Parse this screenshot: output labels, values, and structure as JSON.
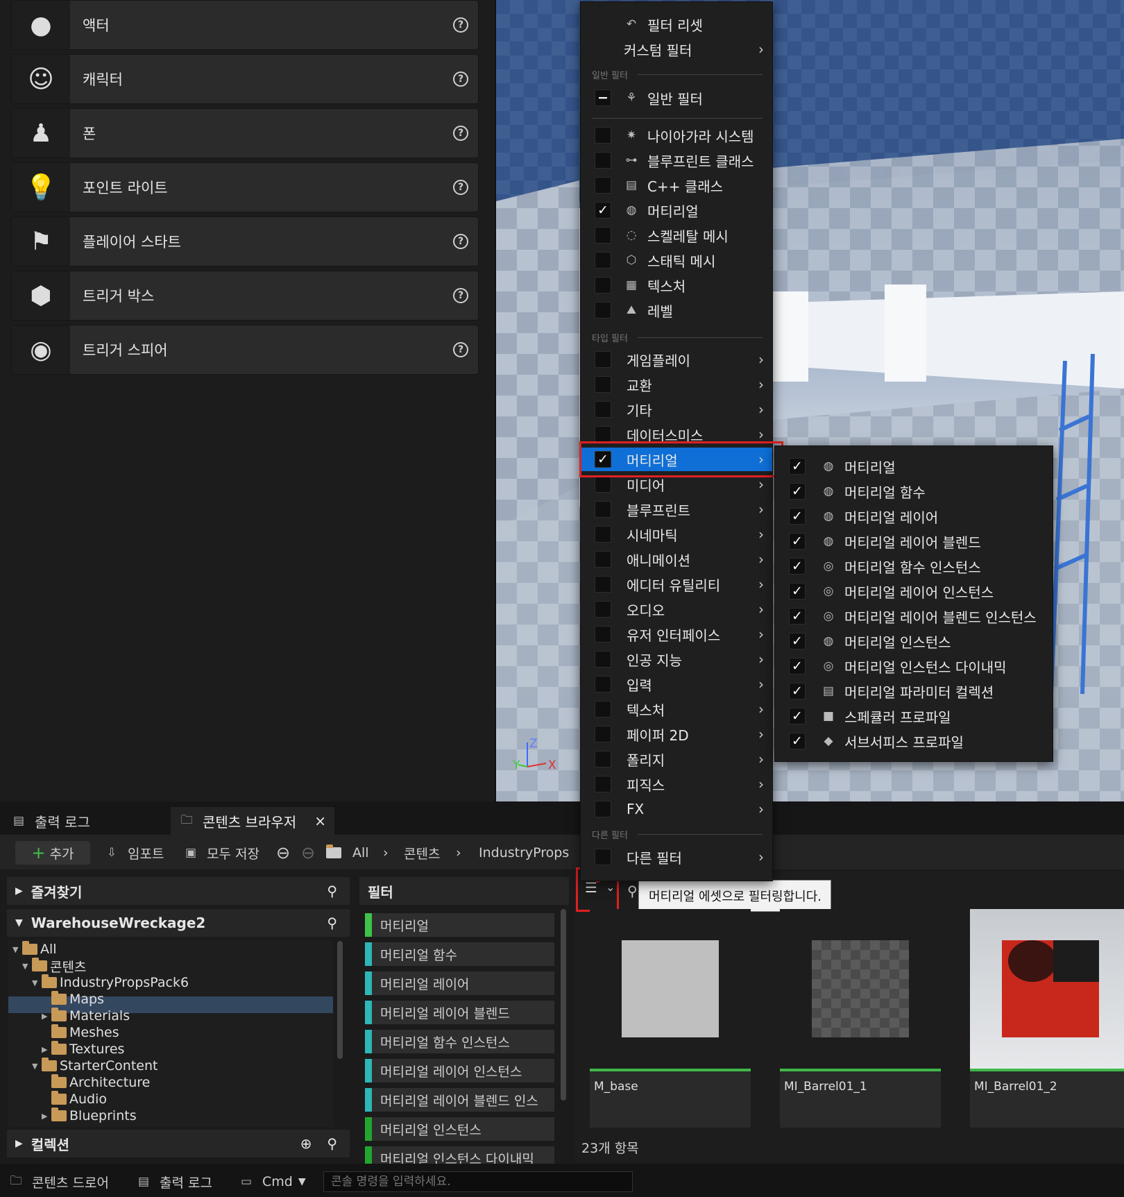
{
  "place_actors": [
    {
      "label": "액터",
      "icon": "sphere-icon"
    },
    {
      "label": "캐릭터",
      "icon": "character-icon"
    },
    {
      "label": "폰",
      "icon": "pawn-icon"
    },
    {
      "label": "포인트 라이트",
      "icon": "lightbulb-icon"
    },
    {
      "label": "플레이어 스타트",
      "icon": "player-start-flag-icon"
    },
    {
      "label": "트리거 박스",
      "icon": "trigger-box-icon"
    },
    {
      "label": "트리거 스피어",
      "icon": "trigger-sphere-icon"
    }
  ],
  "viewport": {
    "axis_x": "X",
    "axis_y": "Y",
    "axis_z": "Z"
  },
  "filter_menu": {
    "reset": "필터 리셋",
    "custom": "커스텀 필터",
    "common_header": "일반 필터",
    "common_filter": "일반 필터",
    "common_items": [
      {
        "label": "나이아가라 시스템",
        "checked": false
      },
      {
        "label": "블루프린트 클래스",
        "checked": false
      },
      {
        "label": "C++ 클래스",
        "checked": false
      },
      {
        "label": "머티리얼",
        "checked": true
      },
      {
        "label": "스켈레탈 메시",
        "checked": false
      },
      {
        "label": "스태틱 메시",
        "checked": false
      },
      {
        "label": "텍스처",
        "checked": false
      },
      {
        "label": "레벨",
        "checked": false
      }
    ],
    "type_header": "타입 필터",
    "type_items": [
      {
        "label": "게임플레이",
        "checked": false
      },
      {
        "label": "교환",
        "checked": false
      },
      {
        "label": "기타",
        "checked": false
      },
      {
        "label": "데이터스미스",
        "checked": false
      },
      {
        "label": "머티리얼",
        "checked": true,
        "highlighted": true
      },
      {
        "label": "미디어",
        "checked": false
      },
      {
        "label": "블루프린트",
        "checked": false
      },
      {
        "label": "시네마틱",
        "checked": false
      },
      {
        "label": "애니메이션",
        "checked": false
      },
      {
        "label": "에디터 유틸리티",
        "checked": false
      },
      {
        "label": "오디오",
        "checked": false
      },
      {
        "label": "유저 인터페이스",
        "checked": false
      },
      {
        "label": "인공 지능",
        "checked": false
      },
      {
        "label": "입력",
        "checked": false
      },
      {
        "label": "텍스처",
        "checked": false
      },
      {
        "label": "페이퍼 2D",
        "checked": false
      },
      {
        "label": "폴리지",
        "checked": false
      },
      {
        "label": "피직스",
        "checked": false
      },
      {
        "label": "FX",
        "checked": false
      }
    ],
    "other_header": "다른 필터",
    "other_filter": "다른 필터"
  },
  "material_submenu": [
    "머티리얼",
    "머티리얼 함수",
    "머티리얼 레이어",
    "머티리얼 레이어 블렌드",
    "머티리얼 함수 인스턴스",
    "머티리얼 레이어 인스턴스",
    "머티리얼 레이어 블렌드 인스턴스",
    "머티리얼 인스턴스",
    "머티리얼 인스턴스 다이내믹",
    "머티리얼 파라미터 컬렉션",
    "스페큘러 프로파일",
    "서브서피스 프로파일"
  ],
  "tabs": {
    "output_log": "출력 로그",
    "content_browser": "콘텐츠 브라우저",
    "close": "×"
  },
  "toolbar": {
    "add": "추가",
    "import": "임포트",
    "save_all": "모두 저장",
    "path_all": "All",
    "path_content": "콘텐츠",
    "path_pack": "IndustryPropsPa"
  },
  "favorites": "즐겨찾기",
  "project": "WarehouseWreckage2",
  "tree": [
    {
      "label": "All",
      "depth": 0
    },
    {
      "label": "콘텐츠",
      "depth": 1
    },
    {
      "label": "IndustryPropsPack6",
      "depth": 2
    },
    {
      "label": "Maps",
      "depth": 3
    },
    {
      "label": "Materials",
      "depth": 3
    },
    {
      "label": "Meshes",
      "depth": 3
    },
    {
      "label": "Textures",
      "depth": 3
    },
    {
      "label": "StarterContent",
      "depth": 2
    },
    {
      "label": "Architecture",
      "depth": 3
    },
    {
      "label": "Audio",
      "depth": 3
    },
    {
      "label": "Blueprints",
      "depth": 3
    }
  ],
  "collections": "컬렉션",
  "filters_title": "필터",
  "filter_chips": [
    "머티리얼",
    "머티리얼 함수",
    "머티리얼 레이어",
    "머티리얼 레이어 블렌드",
    "머티리얼 함수 인스턴스",
    "머티리얼 레이어 인스턴스",
    "머티리얼 레이어 블렌드 인스",
    "머티리얼 인스턴스",
    "머티리얼 인스턴스 다이내믹"
  ],
  "tooltip": "머티리얼 에셋으로 필터링합니다.",
  "assets": [
    "M_base",
    "MI_Barrel01_1",
    "MI_Barrel01_2"
  ],
  "item_count": "23개 항목",
  "statusbar": {
    "content_drawer": "콘텐츠 드로어",
    "output_log": "출력 로그",
    "cmd": "Cmd",
    "console_placeholder": "콘솔 명령을 입력하세요."
  }
}
